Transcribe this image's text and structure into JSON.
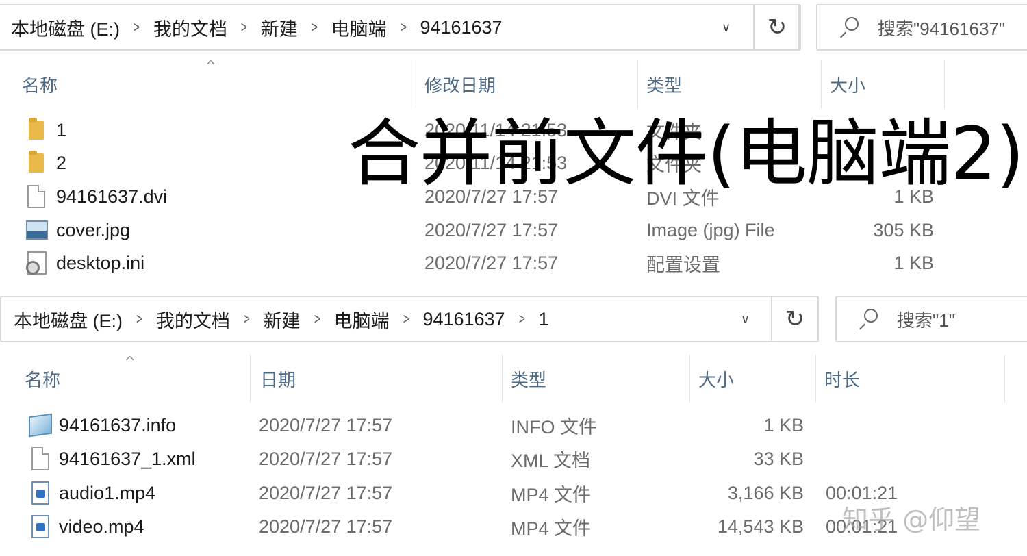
{
  "top": {
    "breadcrumb": [
      "本地磁盘 (E:)",
      "我的文档",
      "新建",
      "电脑端",
      "94161637"
    ],
    "search_placeholder": "搜索\"94161637\"",
    "columns": {
      "name": "名称",
      "modified": "修改日期",
      "type": "类型",
      "size": "大小"
    },
    "rows": [
      {
        "icon": "folder-icon",
        "name": "1",
        "date": "2020/11/14 21:53",
        "type": "文件夹",
        "size": ""
      },
      {
        "icon": "folder-icon",
        "name": "2",
        "date": "2020/11/14 21:53",
        "type": "文件夹",
        "size": ""
      },
      {
        "icon": "document-icon",
        "name": "94161637.dvi",
        "date": "2020/7/27 17:57",
        "type": "DVI 文件",
        "size": "1 KB"
      },
      {
        "icon": "image-icon",
        "name": "cover.jpg",
        "date": "2020/7/27 17:57",
        "type": "Image (jpg) File",
        "size": "305 KB"
      },
      {
        "icon": "settings-file-icon",
        "name": "desktop.ini",
        "date": "2020/7/27 17:57",
        "type": "配置设置",
        "size": "1 KB"
      }
    ]
  },
  "bottom": {
    "breadcrumb": [
      "本地磁盘 (E:)",
      "我的文档",
      "新建",
      "电脑端",
      "94161637",
      "1"
    ],
    "search_placeholder": "搜索\"1\"",
    "columns": {
      "name": "名称",
      "date": "日期",
      "type": "类型",
      "size": "大小",
      "duration": "时长"
    },
    "rows": [
      {
        "icon": "info-file-icon",
        "name": "94161637.info",
        "date": "2020/7/27 17:57",
        "type": "INFO 文件",
        "size": "1 KB",
        "duration": ""
      },
      {
        "icon": "document-icon",
        "name": "94161637_1.xml",
        "date": "2020/7/27 17:57",
        "type": "XML 文档",
        "size": "33 KB",
        "duration": ""
      },
      {
        "icon": "media-file-icon",
        "name": "audio1.mp4",
        "date": "2020/7/27 17:57",
        "type": "MP4 文件",
        "size": "3,166 KB",
        "duration": "00:01:21"
      },
      {
        "icon": "media-file-icon",
        "name": "video.mp4",
        "date": "2020/7/27 17:57",
        "type": "MP4 文件",
        "size": "14,543 KB",
        "duration": "00:01:21"
      }
    ]
  },
  "overlay_caption": "合并前文件(电脑端2)",
  "watermark": "知乎 @仰望",
  "colors": {
    "header_text": "#4d6a84",
    "folder": "#e9b94a",
    "meta_text": "#6b6b6b"
  }
}
